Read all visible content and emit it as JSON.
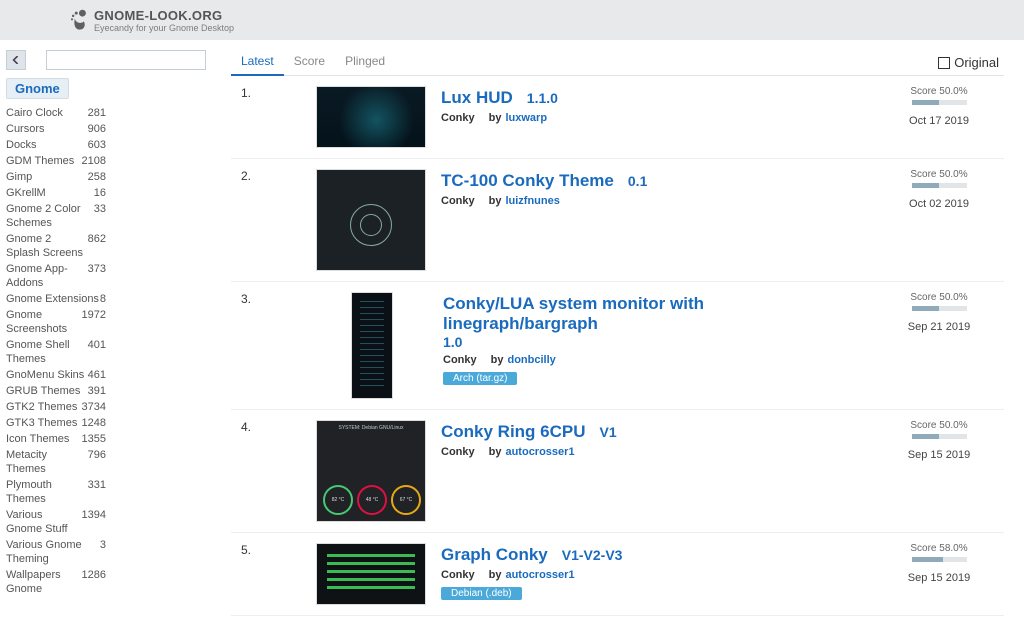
{
  "header": {
    "site_title": "GNOME-LOOK.ORG",
    "site_sub": "Eyecandy for your Gnome Desktop"
  },
  "sidebar": {
    "search_placeholder": "",
    "current_category": "Gnome",
    "categories": [
      {
        "name": "Cairo Clock",
        "count": "281"
      },
      {
        "name": "Cursors",
        "count": "906"
      },
      {
        "name": "Docks",
        "count": "603"
      },
      {
        "name": "GDM Themes",
        "count": "2108"
      },
      {
        "name": "Gimp",
        "count": "258"
      },
      {
        "name": "GKrellM",
        "count": "16"
      },
      {
        "name": "Gnome 2 Color Schemes",
        "count": "33"
      },
      {
        "name": "Gnome 2 Splash Screens",
        "count": "862"
      },
      {
        "name": "Gnome App-Addons",
        "count": "373"
      },
      {
        "name": "Gnome Extensions",
        "count": "8"
      },
      {
        "name": "Gnome Screenshots",
        "count": "1972"
      },
      {
        "name": "Gnome Shell Themes",
        "count": "401"
      },
      {
        "name": "GnoMenu Skins",
        "count": "461"
      },
      {
        "name": "GRUB Themes",
        "count": "391"
      },
      {
        "name": "GTK2 Themes",
        "count": "3734"
      },
      {
        "name": "GTK3 Themes",
        "count": "1248"
      },
      {
        "name": "Icon Themes",
        "count": "1355"
      },
      {
        "name": "Metacity Themes",
        "count": "796"
      },
      {
        "name": "Plymouth Themes",
        "count": "331"
      },
      {
        "name": "Various Gnome Stuff",
        "count": "1394"
      },
      {
        "name": "Various Gnome Theming",
        "count": "3"
      },
      {
        "name": "Wallpapers Gnome",
        "count": "1286"
      }
    ]
  },
  "tabs": {
    "items": [
      "Latest",
      "Score",
      "Plinged"
    ],
    "active": "Latest",
    "original_label": "Original"
  },
  "listing": [
    {
      "rank": "1.",
      "title": "Lux HUD",
      "version": "1.1.0",
      "category": "Conky",
      "by": "by",
      "author": "luxwarp",
      "score_label": "Score 50.0%",
      "score_pct": 50,
      "date": "Oct 17 2019",
      "thumb": "tech-cyan",
      "size": "short",
      "tag": null
    },
    {
      "rank": "2.",
      "title": "TC-100 Conky Theme",
      "version": "0.1",
      "category": "Conky",
      "by": "by",
      "author": "luizfnunes",
      "score_label": "Score 50.0%",
      "score_pct": 50,
      "date": "Oct 02 2019",
      "thumb": "dark-circles",
      "size": "tall",
      "tag": null
    },
    {
      "rank": "3.",
      "title": "Conky/LUA system monitor with linegraph/bargraph",
      "version": "1.0",
      "category": "Conky",
      "by": "by",
      "author": "donbcilly",
      "score_label": "Score 50.0%",
      "score_pct": 50,
      "date": "Sep 21 2019",
      "thumb": "mon-lines",
      "size": "taller",
      "tag": {
        "text": "Arch (tar.gz)",
        "class": "tag-arch"
      }
    },
    {
      "rank": "4.",
      "title": "Conky Ring 6CPU",
      "version": "V1",
      "category": "Conky",
      "by": "by",
      "author": "autocrosser1",
      "score_label": "Score 50.0%",
      "score_pct": 50,
      "date": "Sep 15 2019",
      "thumb": "gauges",
      "size": "square",
      "tag": null
    },
    {
      "rank": "5.",
      "title": "Graph Conky",
      "version": "V1-V2-V3",
      "category": "Conky",
      "by": "by",
      "author": "autocrosser1",
      "score_label": "Score 58.0%",
      "score_pct": 58,
      "date": "Sep 15 2019",
      "thumb": "bars",
      "size": "short",
      "tag": {
        "text": "Debian (.deb)",
        "class": "tag-deb"
      }
    }
  ]
}
